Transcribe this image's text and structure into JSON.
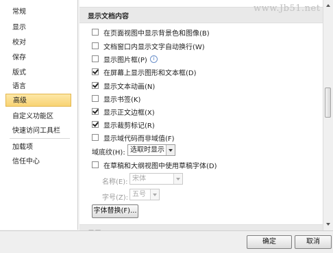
{
  "watermark": "www.Jb51.net",
  "nav": {
    "items": [
      {
        "label": "常规"
      },
      {
        "label": "显示"
      },
      {
        "label": "校对"
      },
      {
        "label": "保存"
      },
      {
        "label": "版式"
      },
      {
        "label": "语言"
      },
      {
        "label": "高级",
        "active": true
      },
      {
        "label": "自定义功能区"
      },
      {
        "label": "快速访问工具栏"
      },
      {
        "label": "加载项"
      },
      {
        "label": "信任中心"
      }
    ]
  },
  "panel": {
    "section_title": "显示文档内容",
    "options": [
      {
        "label": "在页面视图中显示背景色和图像(B)",
        "checked": false
      },
      {
        "label": "文档窗口内显示文字自动换行(W)",
        "checked": false
      },
      {
        "label": "显示图片框(P)",
        "checked": false
      },
      {
        "label": "在屏幕上显示图形和文本框(D)",
        "checked": true
      },
      {
        "label": "显示文本动画(N)",
        "checked": true
      },
      {
        "label": "显示书签(K)",
        "checked": false
      },
      {
        "label": "显示正文边框(X)",
        "checked": true
      },
      {
        "label": "显示裁剪标记(R)",
        "checked": true
      },
      {
        "label": "显示域代码而非域值(F)",
        "checked": false
      }
    ],
    "field_shading": {
      "label": "域底纹(H):",
      "value": "选取时显示"
    },
    "draft_font": {
      "label": "在草稿和大纲视图中使用草稿字体(D)",
      "checked": false
    },
    "font_name": {
      "label": "名称(E):",
      "value": "宋体"
    },
    "font_size": {
      "label": "字号(Z):",
      "value": "五号"
    },
    "font_substitution_button": "字体替换(F)...",
    "next_section_title": "显示"
  },
  "footer": {
    "ok": "确定",
    "cancel": "取消"
  },
  "colors": {
    "active_nav": "#f8d373",
    "section_header": "#e9e9e9"
  }
}
